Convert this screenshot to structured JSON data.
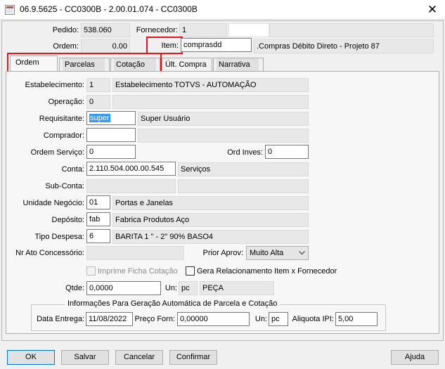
{
  "window": {
    "title": "06.9.5625 - CC0300B - 2.00.01.074 - CC0300B",
    "close_glyph": "✕"
  },
  "header": {
    "pedido_label": "Pedido:",
    "pedido_value": "538.060",
    "fornecedor_label": "Fornecedor:",
    "fornecedor_value": "1",
    "fornecedor_name": "",
    "ordem_label": "Ordem:",
    "ordem_value": "0.00",
    "item_label": "Item:",
    "item_value": "comprasdd",
    "item_desc": ".Compras Débito Direto - Projeto 87"
  },
  "tabs": [
    {
      "label": "Ordem",
      "active": true
    },
    {
      "label": "Parcelas",
      "active": false
    },
    {
      "label": "Cotação",
      "active": false
    },
    {
      "label": "Últ. Compra",
      "active": false
    },
    {
      "label": "Narrativa",
      "active": false
    }
  ],
  "form": {
    "estabelecimento_label": "Estabelecimento:",
    "estabelecimento_code": "1",
    "estabelecimento_name": "Estabelecimento TOTVS - AUTOMAÇÃO",
    "operacao_label": "Operação:",
    "operacao_value": "0",
    "operacao_desc": "",
    "requisitante_label": "Requisitante:",
    "requisitante_value": "super",
    "requisitante_name": "Super Usuário",
    "comprador_label": "Comprador:",
    "comprador_value": "",
    "comprador_name": "",
    "ordem_servico_label": "Ordem Serviço:",
    "ordem_servico_value": "0",
    "ord_inves_label": "Ord Inves:",
    "ord_inves_value": "0",
    "conta_label": "Conta:",
    "conta_value": "2.110.504.000.00.545",
    "conta_desc": "Serviços",
    "subconta_label": "Sub-Conta:",
    "subconta_value": "",
    "subconta_desc": "",
    "unidade_negocio_label": "Unidade Negócio:",
    "unidade_negocio_value": "01",
    "unidade_negocio_desc": "Portas e Janelas",
    "deposito_label": "Depósito:",
    "deposito_value": "fab",
    "deposito_desc": "Fabrica Produtos Aço",
    "tipo_despesa_label": "Tipo Despesa:",
    "tipo_despesa_value": "6",
    "tipo_despesa_desc": "BARITA 1 \" - 2\" 90% BASO4",
    "nr_ato_label": "Nr Ato Concessório:",
    "nr_ato_value": "",
    "prior_aprov_label": "Prior Aprov:",
    "prior_aprov_value": "Muito Alta",
    "imprime_ficha_label": "Imprime Ficha Cotação",
    "imprime_ficha_checked": false,
    "gera_rel_label": "Gera Relacionamento Item x Fornecedor",
    "gera_rel_checked": false,
    "qtde_label": "Qtde:",
    "qtde_value": "0,0000",
    "un_label": "Un:",
    "un_value": "pc",
    "un_desc": "PEÇA"
  },
  "group": {
    "title": "Informações Para Geração Automática de Parcela e Cotação",
    "data_entrega_label": "Data Entrega:",
    "data_entrega_value": "11/08/2022",
    "preco_forn_label": "Preço Forn:",
    "preco_forn_value": "0,00000",
    "un_label": "Un:",
    "un_value": "pc",
    "aliquota_label": "Aliquota IPI:",
    "aliquota_value": "5,00"
  },
  "buttons": {
    "ok": "OK",
    "salvar": "Salvar",
    "cancelar": "Cancelar",
    "confirmar": "Confirmar",
    "ajuda": "Ajuda"
  },
  "colors": {
    "highlight_red": "#e8141b",
    "selection_blue": "#3399ff"
  }
}
